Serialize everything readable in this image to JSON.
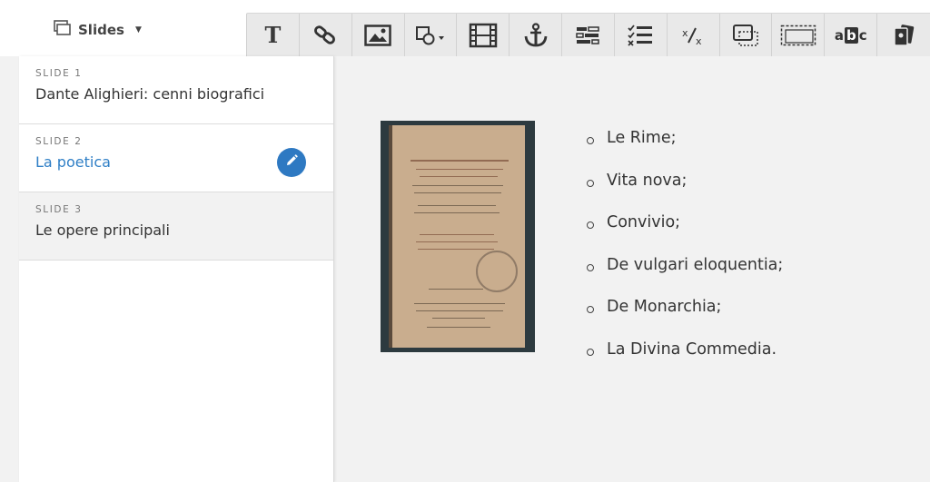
{
  "header": {
    "menu_label": "Slides"
  },
  "toolbar": {
    "text_tool_glyph": "T",
    "spell_tool_text": [
      "a",
      "b",
      "c"
    ],
    "fraction_glyph": "⁄",
    "textbox_label": "abc"
  },
  "sidebar": {
    "slides": [
      {
        "number": "SLIDE 1",
        "title": "Dante Alighieri: cenni biografici"
      },
      {
        "number": "SLIDE 2",
        "title": "La poetica"
      },
      {
        "number": "SLIDE 3",
        "title": "Le opere principali"
      }
    ]
  },
  "main": {
    "bullets": [
      "Le Rime;",
      "Vita nova;",
      "Convivio;",
      "De vulgari eloquentia;",
      "De Monarchia;",
      "La Divina Commedia."
    ]
  },
  "colors": {
    "accent": "#2e79c2",
    "selected_title": "#2f7fc6",
    "active_row": "#f2f2f2"
  }
}
